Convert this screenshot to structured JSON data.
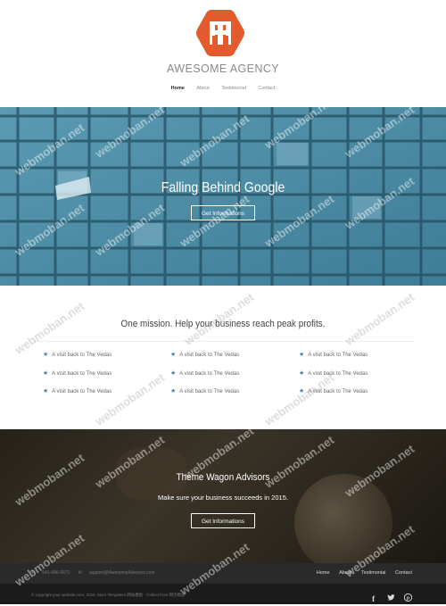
{
  "brand": {
    "name": "AWESOME AGENCY",
    "logo_color": "#e35a2c"
  },
  "nav": [
    {
      "label": "Home",
      "active": true
    },
    {
      "label": "About",
      "active": false
    },
    {
      "label": "Testimonial",
      "active": false
    },
    {
      "label": "Contact",
      "active": false
    }
  ],
  "hero": {
    "title": "Falling Behind Google",
    "button": "Get Informations",
    "tint": "#4e8fa7"
  },
  "mission": {
    "title": "One mission. Help your business reach peak profits.",
    "features": [
      "A visit back to The Vedas",
      "A visit back to The Vedas",
      "A visit back to The Vedas",
      "A visit back to The Vedas",
      "A visit back to The Vedas",
      "A visit back to The Vedas",
      "A visit back to The Vedas",
      "A visit back to The Vedas",
      "A visit back to The Vedas"
    ]
  },
  "advisors": {
    "title": "Theme Wagon Advisors",
    "subtitle": "Make sure your business succeeds in 2015.",
    "button": "Get Informations"
  },
  "footer": {
    "phone": "541-996-0671",
    "email": "support@AwesomeAdvisors.com",
    "nav": [
      "Home",
      "About",
      "Testimonial",
      "Contact"
    ],
    "copyright": "© copyright your website.com, 2015. More Templates 网站模板 - Collect from 网页模板",
    "social": [
      "facebook-icon",
      "twitter-icon",
      "pinterest-icon"
    ]
  },
  "watermark": "webmoban.net"
}
